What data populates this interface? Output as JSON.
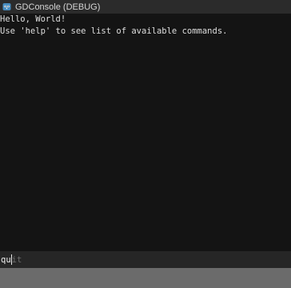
{
  "window": {
    "title": "GDConsole (DEBUG)",
    "app_icon": "godot-icon"
  },
  "console": {
    "lines": [
      "Hello, World!",
      "Use 'help' to see list of available commands."
    ]
  },
  "input": {
    "typed_text": "qu",
    "suggestion_completion": "it"
  },
  "colors": {
    "background": "#141414",
    "titlebar": "#2b2b2b",
    "input_bar": "#262626",
    "bottom_bar": "#6b6b6b",
    "text": "#dedede",
    "suggestion": "#6e6e6e"
  }
}
